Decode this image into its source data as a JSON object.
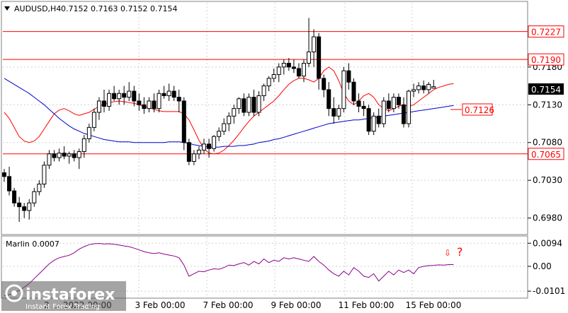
{
  "chart_data": [
    {
      "type": "candlestick",
      "symbol_label": "AUDUSD,H4",
      "ohlc_label": "0.7152 0.7163 0.7152 0.7154",
      "ylim": [
        0.696,
        0.7265
      ],
      "y_ticks": [
        "0.6980",
        "0.7030",
        "0.7080",
        "0.7130",
        "0.7180"
      ],
      "x_ticks": [
        "3 Feb 00:00",
        "7 Feb 00:00",
        "9 Feb 00:00",
        "11 Feb 00:00",
        "15 Feb 00:00"
      ],
      "x_ticks_truncated": "2 ... 2022 00:00",
      "price_label": "0.7154",
      "levels": [
        {
          "value": 0.7227,
          "label": "0.7227",
          "color": "#ff0000"
        },
        {
          "value": 0.719,
          "label": "0.7190",
          "color": "#ff0000"
        },
        {
          "value": 0.7065,
          "label": "0.7065",
          "color": "#ff0000"
        }
      ],
      "annotation_label": "0.7126",
      "candles": [
        [
          0.704,
          0.7045,
          0.7028,
          0.7035
        ],
        [
          0.7035,
          0.7048,
          0.701,
          0.7016
        ],
        [
          0.7016,
          0.702,
          0.6995,
          0.7
        ],
        [
          0.7,
          0.7008,
          0.6975,
          0.6995
        ],
        [
          0.6995,
          0.7,
          0.698,
          0.699
        ],
        [
          0.699,
          0.7005,
          0.6978,
          0.7
        ],
        [
          0.7,
          0.702,
          0.6995,
          0.7015
        ],
        [
          0.7015,
          0.703,
          0.701,
          0.7025
        ],
        [
          0.7025,
          0.7055,
          0.702,
          0.705
        ],
        [
          0.705,
          0.707,
          0.7045,
          0.7065
        ],
        [
          0.7065,
          0.707,
          0.7055,
          0.706
        ],
        [
          0.706,
          0.7072,
          0.7055,
          0.7066
        ],
        [
          0.7066,
          0.7075,
          0.7058,
          0.7062
        ],
        [
          0.7062,
          0.7068,
          0.7052,
          0.7065
        ],
        [
          0.7065,
          0.707,
          0.7055,
          0.706
        ],
        [
          0.706,
          0.7072,
          0.7045,
          0.7068
        ],
        [
          0.7068,
          0.709,
          0.706,
          0.7085
        ],
        [
          0.7085,
          0.7105,
          0.708,
          0.71
        ],
        [
          0.71,
          0.7125,
          0.7095,
          0.712
        ],
        [
          0.712,
          0.714,
          0.711,
          0.7135
        ],
        [
          0.7135,
          0.715,
          0.712,
          0.7128
        ],
        [
          0.7128,
          0.715,
          0.7122,
          0.7145
        ],
        [
          0.7145,
          0.7155,
          0.7135,
          0.7138
        ],
        [
          0.7138,
          0.715,
          0.713,
          0.7145
        ],
        [
          0.7145,
          0.7155,
          0.713,
          0.714
        ],
        [
          0.714,
          0.716,
          0.7135,
          0.7148
        ],
        [
          0.7148,
          0.7155,
          0.7128,
          0.7135
        ],
        [
          0.7135,
          0.7145,
          0.7122,
          0.713
        ],
        [
          0.713,
          0.714,
          0.7118,
          0.7125
        ],
        [
          0.7125,
          0.714,
          0.712,
          0.7135
        ],
        [
          0.7135,
          0.7145,
          0.712,
          0.7125
        ],
        [
          0.7125,
          0.715,
          0.712,
          0.7145
        ],
        [
          0.7145,
          0.7155,
          0.7138,
          0.7142
        ],
        [
          0.7142,
          0.7158,
          0.7135,
          0.7148
        ],
        [
          0.7148,
          0.7155,
          0.7135,
          0.714
        ],
        [
          0.714,
          0.715,
          0.712,
          0.7135
        ],
        [
          0.7135,
          0.714,
          0.707,
          0.708
        ],
        [
          0.708,
          0.7085,
          0.705,
          0.7055
        ],
        [
          0.7055,
          0.707,
          0.705,
          0.7065
        ],
        [
          0.7065,
          0.7075,
          0.7058,
          0.707
        ],
        [
          0.707,
          0.7085,
          0.7065,
          0.7078
        ],
        [
          0.7078,
          0.7085,
          0.706,
          0.7072
        ],
        [
          0.7072,
          0.709,
          0.7068,
          0.7088
        ],
        [
          0.7088,
          0.71,
          0.7082,
          0.7095
        ],
        [
          0.7095,
          0.7112,
          0.709,
          0.7105
        ],
        [
          0.7105,
          0.712,
          0.7095,
          0.7115
        ],
        [
          0.7115,
          0.713,
          0.7105,
          0.7125
        ],
        [
          0.7125,
          0.714,
          0.7118,
          0.7138
        ],
        [
          0.7138,
          0.7145,
          0.7115,
          0.712
        ],
        [
          0.712,
          0.7145,
          0.7115,
          0.714
        ],
        [
          0.714,
          0.715,
          0.7115,
          0.712
        ],
        [
          0.712,
          0.7148,
          0.7115,
          0.7142
        ],
        [
          0.7142,
          0.7158,
          0.7135,
          0.7155
        ],
        [
          0.7155,
          0.7168,
          0.7148,
          0.7165
        ],
        [
          0.7165,
          0.7178,
          0.716,
          0.717
        ],
        [
          0.717,
          0.7185,
          0.716,
          0.718
        ],
        [
          0.718,
          0.719,
          0.717,
          0.7185
        ],
        [
          0.7185,
          0.7192,
          0.7175,
          0.718
        ],
        [
          0.718,
          0.719,
          0.7172,
          0.7178
        ],
        [
          0.7178,
          0.7185,
          0.7165,
          0.7168
        ],
        [
          0.7168,
          0.719,
          0.716,
          0.7185
        ],
        [
          0.7185,
          0.7245,
          0.718,
          0.72
        ],
        [
          0.72,
          0.723,
          0.718,
          0.722
        ],
        [
          0.722,
          0.7225,
          0.715,
          0.7165
        ],
        [
          0.7165,
          0.717,
          0.714,
          0.715
        ],
        [
          0.715,
          0.716,
          0.7115,
          0.7125
        ],
        [
          0.7125,
          0.714,
          0.7105,
          0.7115
        ],
        [
          0.7115,
          0.713,
          0.711,
          0.7125
        ],
        [
          0.7125,
          0.718,
          0.712,
          0.7175
        ],
        [
          0.7175,
          0.7185,
          0.715,
          0.716
        ],
        [
          0.716,
          0.7165,
          0.713,
          0.7135
        ],
        [
          0.7135,
          0.7145,
          0.712,
          0.7128
        ],
        [
          0.7128,
          0.7135,
          0.7115,
          0.7125
        ],
        [
          0.7125,
          0.713,
          0.709,
          0.7095
        ],
        [
          0.7095,
          0.712,
          0.709,
          0.7115
        ],
        [
          0.7115,
          0.7125,
          0.71,
          0.7105
        ],
        [
          0.7105,
          0.714,
          0.71,
          0.7135
        ],
        [
          0.7135,
          0.7145,
          0.712,
          0.7125
        ],
        [
          0.7125,
          0.7145,
          0.712,
          0.714
        ],
        [
          0.714,
          0.7145,
          0.7125,
          0.713
        ],
        [
          0.713,
          0.714,
          0.71,
          0.7105
        ],
        [
          0.7105,
          0.715,
          0.71,
          0.7148
        ],
        [
          0.7148,
          0.7158,
          0.714,
          0.715
        ],
        [
          0.715,
          0.716,
          0.7145,
          0.7155
        ],
        [
          0.7155,
          0.7162,
          0.7145,
          0.715
        ],
        [
          0.715,
          0.716,
          0.7145,
          0.7157
        ],
        [
          0.7152,
          0.7163,
          0.7152,
          0.7154
        ]
      ],
      "series": [
        {
          "kind": "moving_average",
          "color": "#ff0000",
          "values": [
            0.712,
            0.7112,
            0.71,
            0.7088,
            0.7082,
            0.708,
            0.7082,
            0.7088,
            0.7098,
            0.7108,
            0.7118,
            0.7123,
            0.7125,
            0.7122,
            0.7118,
            0.7116,
            0.7118,
            0.712,
            0.7124,
            0.7128,
            0.7131,
            0.7133,
            0.7134,
            0.7135,
            0.7134,
            0.7133,
            0.7132,
            0.713,
            0.7128,
            0.7126,
            0.7124,
            0.7122,
            0.7121,
            0.7121,
            0.7121,
            0.7121,
            0.7118,
            0.711,
            0.7097,
            0.7083,
            0.7072,
            0.7066,
            0.7065,
            0.7066,
            0.707,
            0.7076,
            0.7083,
            0.7091,
            0.71,
            0.7108,
            0.7115,
            0.712,
            0.7125,
            0.713,
            0.7135,
            0.7142,
            0.715,
            0.7157,
            0.7162,
            0.7165,
            0.7165,
            0.7163,
            0.716,
            0.7165,
            0.7175,
            0.718,
            0.7175,
            0.7162,
            0.7145,
            0.7135,
            0.713,
            0.7135,
            0.7142,
            0.7145,
            0.714,
            0.713,
            0.7125,
            0.7122,
            0.7125,
            0.7128,
            0.713,
            0.7128,
            0.713,
            0.7135,
            0.714,
            0.7145,
            0.715,
            0.7153,
            0.7155,
            0.7157,
            0.7158
          ]
        },
        {
          "kind": "moving_average",
          "color": "#0000cc",
          "values": [
            0.7165,
            0.7161,
            0.7157,
            0.7153,
            0.7149,
            0.7145,
            0.714,
            0.7135,
            0.713,
            0.7124,
            0.7118,
            0.7112,
            0.7107,
            0.7102,
            0.7098,
            0.7095,
            0.7092,
            0.709,
            0.7088,
            0.7086,
            0.7084,
            0.7083,
            0.7082,
            0.7081,
            0.7081,
            0.7081,
            0.708,
            0.708,
            0.708,
            0.708,
            0.708,
            0.708,
            0.708,
            0.7081,
            0.7081,
            0.7081,
            0.708,
            0.7079,
            0.7077,
            0.7076,
            0.7075,
            0.7074,
            0.7074,
            0.7074,
            0.7075,
            0.7075,
            0.7075,
            0.7076,
            0.7076,
            0.7077,
            0.7078,
            0.708,
            0.7081,
            0.7082,
            0.7084,
            0.7085,
            0.7087,
            0.7089,
            0.7091,
            0.7093,
            0.7095,
            0.7097,
            0.7099,
            0.7101,
            0.7103,
            0.7105,
            0.7106,
            0.7107,
            0.7108,
            0.7109,
            0.711,
            0.711,
            0.7111,
            0.7112,
            0.7113,
            0.7114,
            0.7115,
            0.7116,
            0.7117,
            0.7118,
            0.7119,
            0.712,
            0.7121,
            0.7122,
            0.7123,
            0.7124,
            0.7125,
            0.7126,
            0.7127,
            0.7128,
            0.7129
          ]
        }
      ]
    },
    {
      "type": "line",
      "indicator_label": "Marlin 0.0007",
      "ylim": [
        -0.0118,
        0.0112
      ],
      "y_ticks": [
        "0.0094",
        "0.00",
        "-0.0101"
      ],
      "annotation_symbols": [
        "⇩",
        "?"
      ],
      "series": [
        {
          "color": "#8b008b",
          "values": [
            -0.012,
            -0.0115,
            -0.0108,
            -0.0098,
            -0.0085,
            -0.007,
            -0.005,
            -0.003,
            -0.001,
            0.001,
            0.0025,
            0.0035,
            0.004,
            0.0045,
            0.0055,
            0.007,
            0.008,
            0.0088,
            0.0092,
            0.0093,
            0.0091,
            0.0092,
            0.009,
            0.0087,
            0.0083,
            0.008,
            0.0074,
            0.0067,
            0.006,
            0.0055,
            0.0052,
            0.0055,
            0.005,
            0.0046,
            0.0042,
            0.0035,
            0.0005,
            -0.004,
            -0.003,
            -0.002,
            -0.0022,
            -0.0015,
            -0.001,
            -0.0012,
            -0.0005,
            0.0005,
            0.0003,
            0.001,
            0.0015,
            0.0005,
            0.002,
            0.001,
            0.003,
            0.0015,
            0.0025,
            0.002,
            0.0035,
            0.003,
            0.0035,
            0.003,
            0.0025,
            0.002,
            0.004,
            0.002,
            0.0005,
            -0.0015,
            -0.003,
            -0.004,
            -0.002,
            -0.0035,
            -0.0005,
            -0.002,
            -0.004,
            -0.0045,
            -0.003,
            -0.006,
            -0.004,
            -0.002,
            -0.0035,
            -0.0015,
            -0.0025,
            -0.0015,
            -0.003,
            -0.0005,
            0.0,
            0.0003,
            0.0004,
            0.0006,
            0.0005,
            0.0007,
            0.0007
          ]
        }
      ]
    }
  ],
  "watermark": {
    "brand": "instaforex",
    "tagline": "Instant Forex Trading"
  },
  "colors": {
    "up_candle": "#ffffff",
    "down_candle": "#000000",
    "grid": "#d0d0d0",
    "level": "#ff0000",
    "price_box": "#000000"
  }
}
